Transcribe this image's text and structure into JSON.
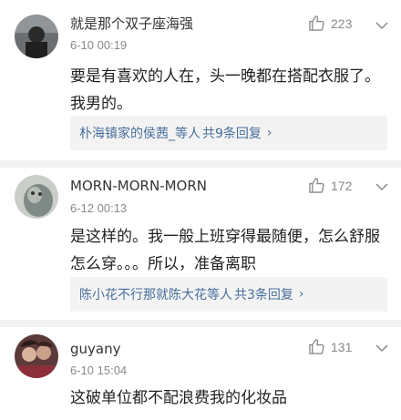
{
  "comments": [
    {
      "username": "就是那个双子座海强",
      "time": "6-10 00:19",
      "likes": "223",
      "text": "要是有喜欢的人在，头一晚都在搭配衣服了。我男的。",
      "reply_names": "朴海镇家的侯茜_等人",
      "reply_count": "共9条回复"
    },
    {
      "username": "MORN-MORN-MORN",
      "time": "6-12 00:13",
      "likes": "172",
      "text": "是这样的。我一般上班穿得最随便，怎么舒服怎么穿。。。所以，准备离职",
      "reply_names": "陈小花不行那就陈大花等人",
      "reply_count": "共3条回复"
    },
    {
      "username": "guyany",
      "time": "6-10 15:04",
      "likes": "131",
      "text": "这破单位都不配浪费我的化妆品"
    }
  ],
  "icons": {
    "like": "thumbs-up-icon",
    "more": "chevron-down-icon",
    "reply_arrow": "›"
  },
  "colors": {
    "link": "#486f9c",
    "meta": "#8a8a8a",
    "divider": "#f2f2f2",
    "reply_bg": "#f3f3f3"
  }
}
